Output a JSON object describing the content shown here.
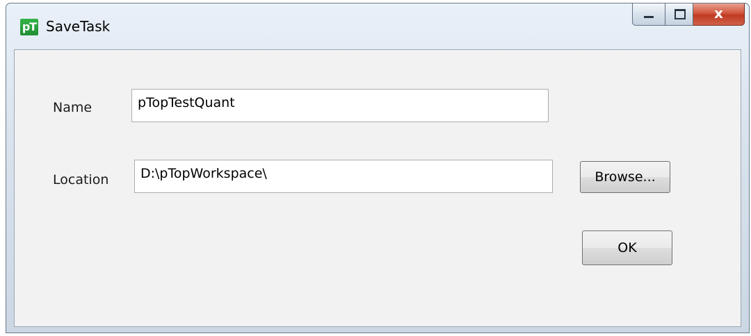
{
  "window": {
    "title": "SaveTask",
    "app_icon_text": "pT",
    "controls": {
      "minimize_icon": "minimize-icon",
      "maximize_icon": "maximize-icon",
      "close_icon": "close-icon",
      "close_glyph": "x"
    }
  },
  "form": {
    "name_label": "Name",
    "name_value": "pTopTestQuant",
    "location_label": "Location",
    "location_value": "D:\\pTopWorkspace\\",
    "browse_label": "Browse...",
    "ok_label": "OK"
  },
  "colors": {
    "close_button": "#c9452c",
    "app_icon": "#2aa040",
    "client_background": "#f2f2f3"
  }
}
